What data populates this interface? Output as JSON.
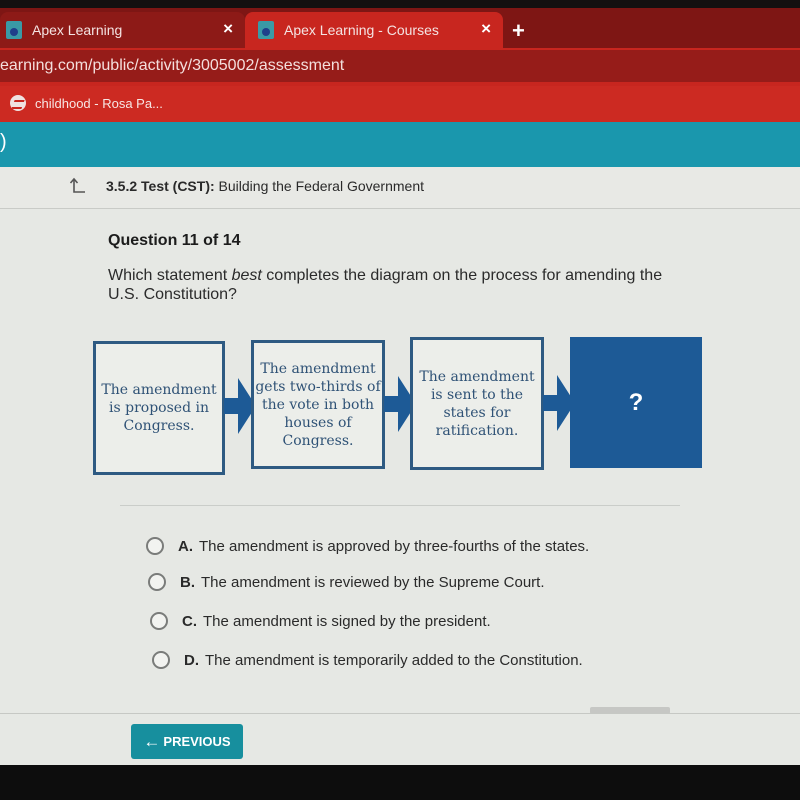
{
  "browser": {
    "tabs": [
      {
        "title": "Apex Learning",
        "icon": "apex-favicon",
        "active": false
      },
      {
        "title": "Apex Learning - Courses",
        "icon": "apex-favicon",
        "active": true
      }
    ],
    "close_glyph": "×",
    "new_tab_glyph": "+",
    "url": "earning.com/public/activity/3005002/assessment",
    "bookmarks": [
      {
        "label": "childhood - Rosa Pa...",
        "icon": "globe-icon"
      }
    ]
  },
  "header": {
    "left_glyph": ")"
  },
  "breadcrumb": {
    "icon": "up-arrow-icon",
    "section": "3.5.2 Test (CST):",
    "title": "Building the Federal Government"
  },
  "question": {
    "title": "Question 11 of 14",
    "text_before": "Which statement ",
    "text_emphasis": "best",
    "text_after": " completes the diagram on the process for amending the U.S. Constitution?"
  },
  "diagram": {
    "steps": [
      "The amendment is proposed in Congress.",
      "The amendment gets two-thirds of the vote in both houses of Congress.",
      "The amendment is sent to the states for ratification.",
      "?"
    ],
    "colors": {
      "border": "#2e5a82",
      "final_fill": "#1d5a96"
    }
  },
  "choices": [
    {
      "letter": "A.",
      "text": "The amendment is approved by three-fourths of the states."
    },
    {
      "letter": "B.",
      "text": "The amendment is reviewed by the Supreme Court."
    },
    {
      "letter": "C.",
      "text": "The amendment is signed by the president."
    },
    {
      "letter": "D.",
      "text": "The amendment is temporarily added to the Constitution."
    }
  ],
  "navigation": {
    "previous_label": "PREVIOUS",
    "previous_icon": "arrow-left-icon"
  },
  "colors": {
    "browser_red": "#c8261f",
    "header_teal": "#1a97ad",
    "button_teal": "#178f9e"
  }
}
